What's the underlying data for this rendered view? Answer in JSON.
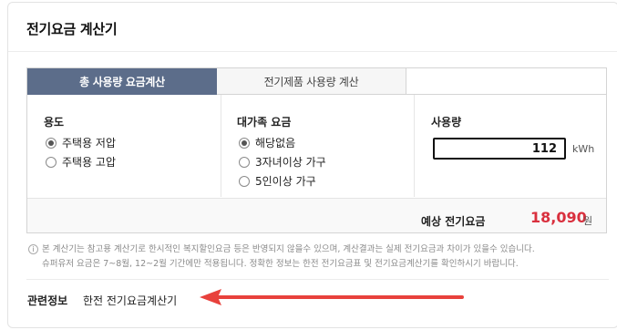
{
  "title": "전기요금 계산기",
  "tabs": [
    {
      "label": "총 사용량 요금계산"
    },
    {
      "label": "전기제품 사용량 계산"
    }
  ],
  "usage_type": {
    "heading": "용도",
    "options": [
      {
        "label": "주택용 저압",
        "selected": true
      },
      {
        "label": "주택용 고압",
        "selected": false
      }
    ]
  },
  "family_rate": {
    "heading": "대가족 요금",
    "options": [
      {
        "label": "해당없음",
        "selected": true
      },
      {
        "label": "3자녀이상 가구",
        "selected": false
      },
      {
        "label": "5인이상 가구",
        "selected": false
      }
    ]
  },
  "usage": {
    "heading": "사용량",
    "value": "112",
    "unit": "kWh"
  },
  "result": {
    "label": "예상 전기요금",
    "value": "18,090",
    "unit": "원"
  },
  "notice": {
    "icon": "info-icon",
    "line1": "본 계산기는 참고용 계산기로 한시적인 복지할인요금 등은 반영되지 않을수 있으며, 계산결과는 실제 전기요금과 차이가 있을수 있습니다.",
    "line2": "슈퍼유저 요금은 7~8월, 12~2월 기간에만 적용됩니다. 정확한 정보는 한전 전기요금표 및 전기요금계산기를 확인하시기 바랍니다."
  },
  "related": {
    "label": "관련정보",
    "link": "한전 전기요금계산기"
  },
  "colors": {
    "active_tab": "#5c6d8a",
    "result_value": "#d9303e",
    "annotation_arrow": "#e8413c"
  }
}
